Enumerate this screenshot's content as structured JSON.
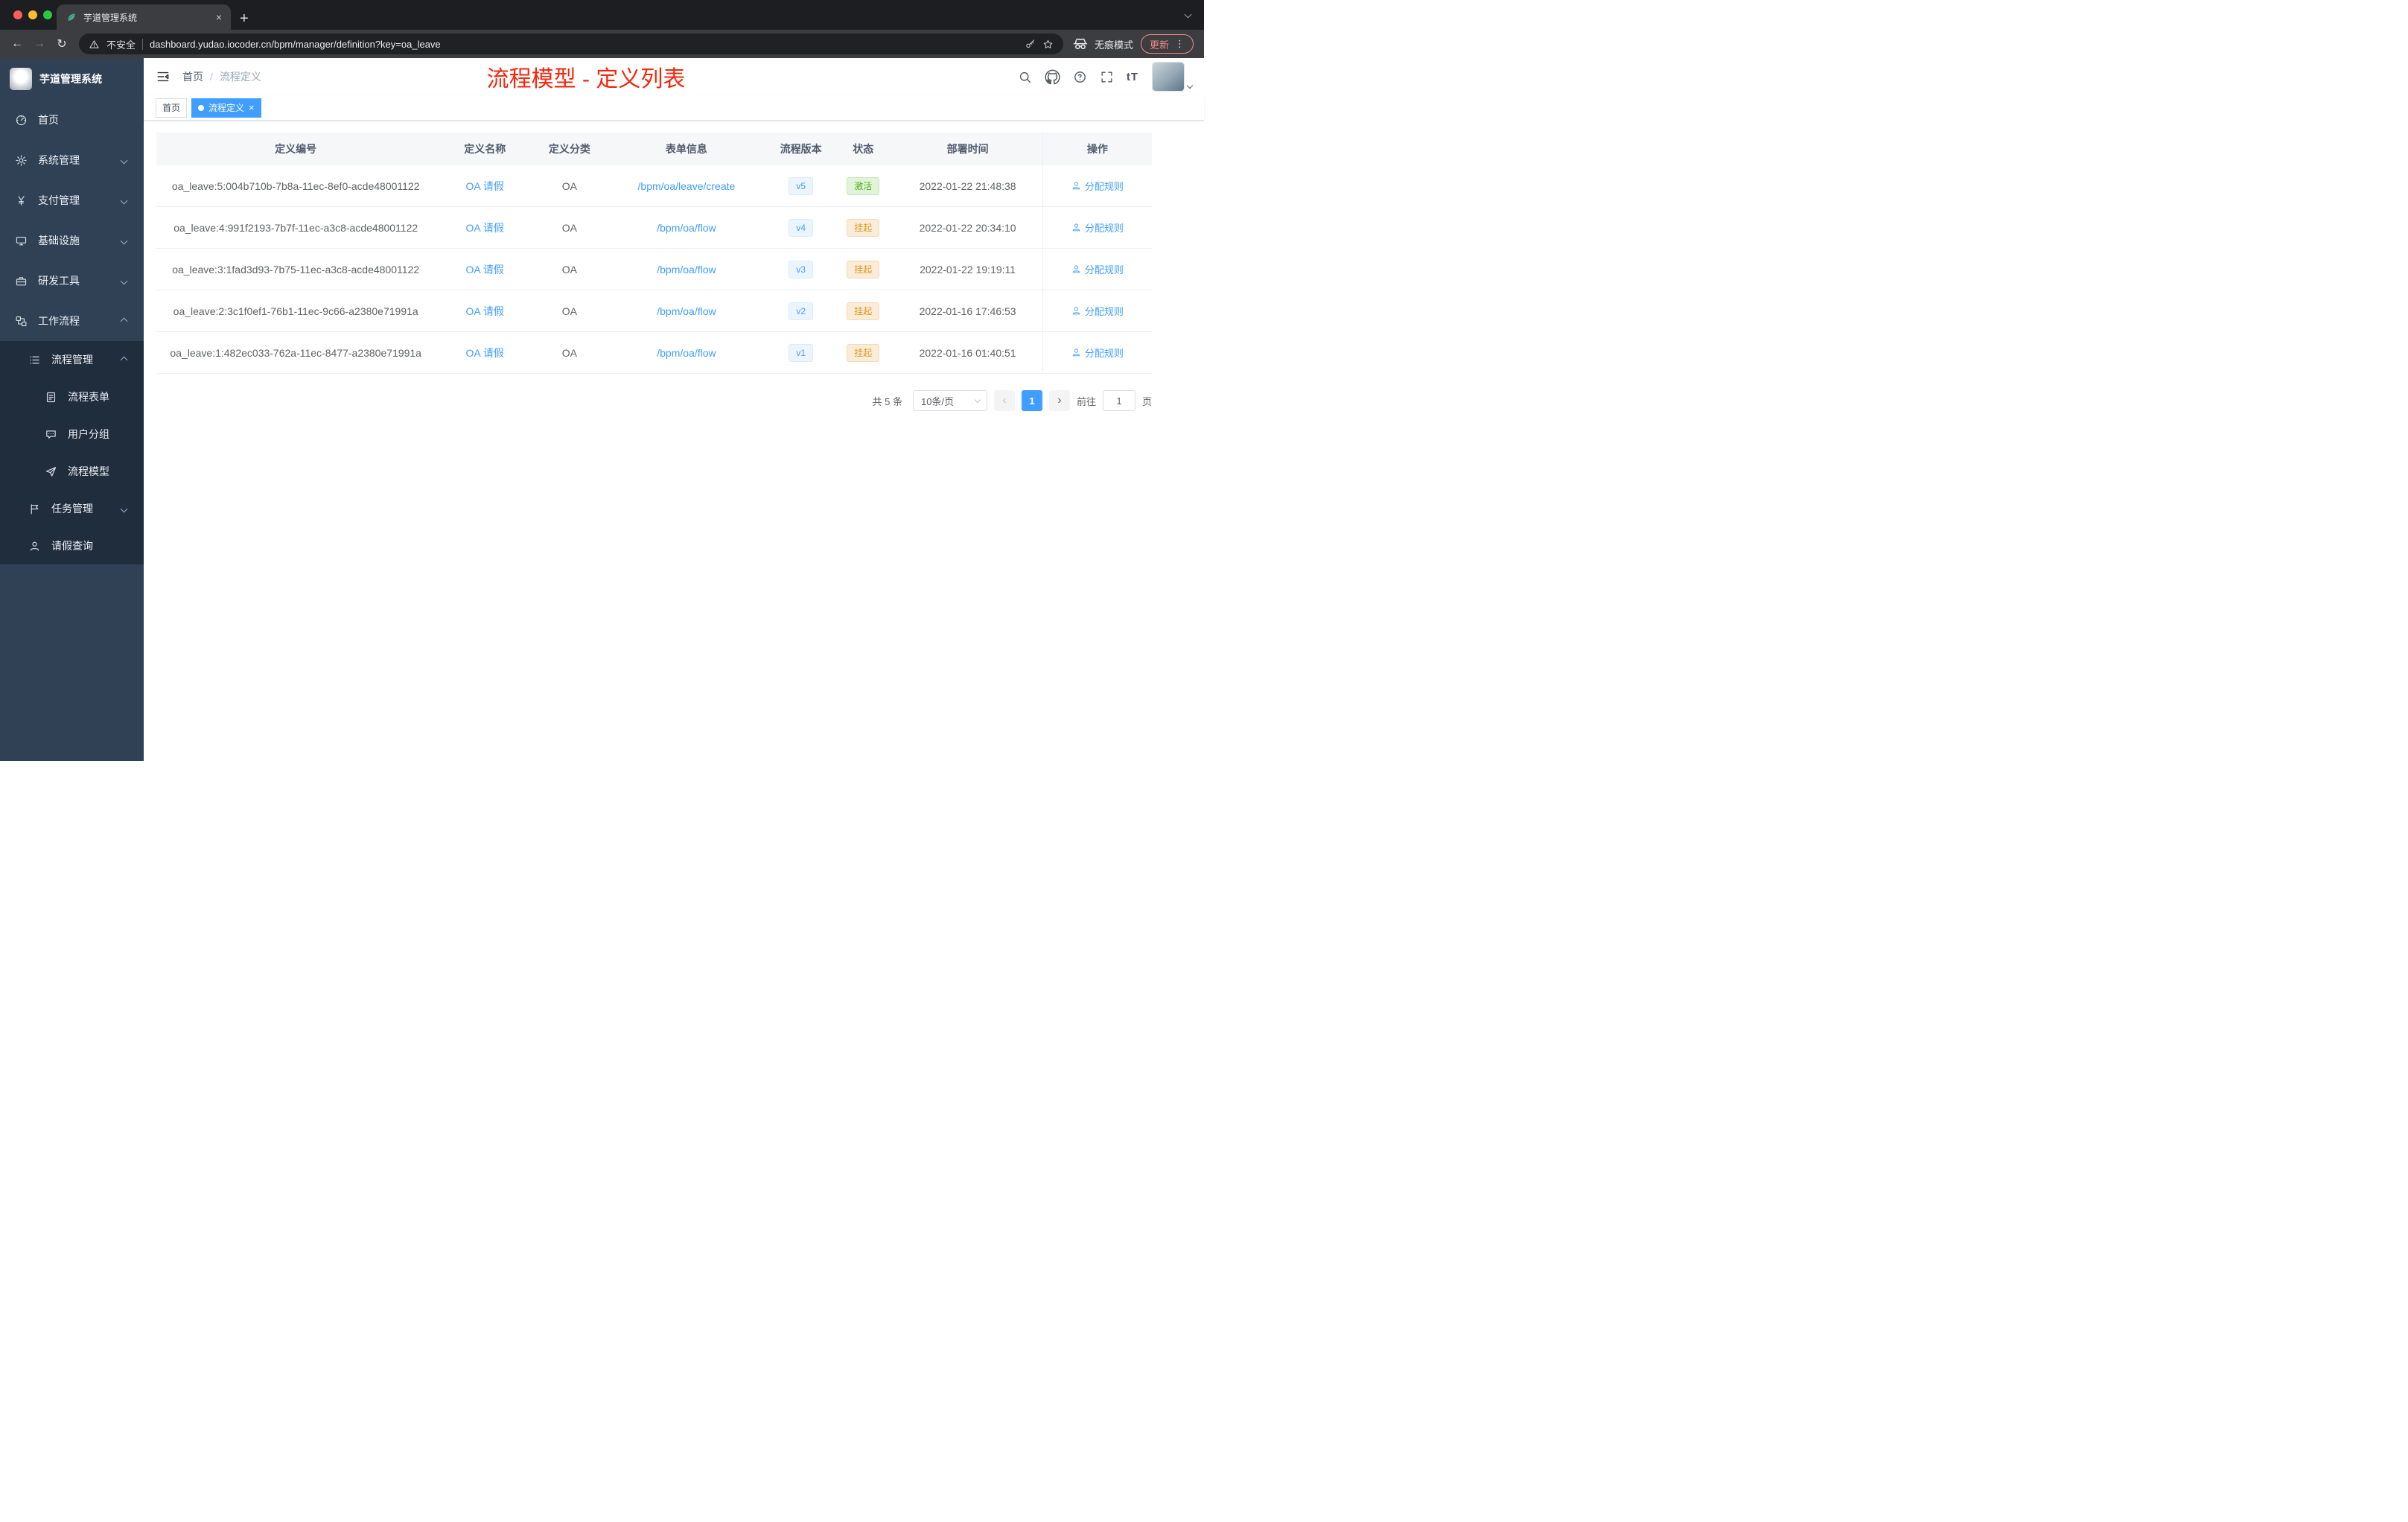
{
  "colors": {
    "accent": "#409eff",
    "sidebar_bg": "#304156",
    "submenu_bg": "#1f2d3d",
    "annotation_red": "#f2270c",
    "status_active_text": "#58b025",
    "status_suspend_text": "#dc9a22",
    "tag_active_bg": "#409eff"
  },
  "glyphs": {
    "close": "×",
    "plus": "+",
    "kebab": "⋮",
    "back": "←",
    "forward": "→",
    "reload": "↻",
    "prev": "‹",
    "next": "›"
  },
  "browser": {
    "tab_title": "芋道管理系统",
    "security_label": "不安全",
    "url": "dashboard.yudao.iocoder.cn/bpm/manager/definition?key=oa_leave",
    "incognito_label": "无痕模式",
    "update_label": "更新"
  },
  "sidebar": {
    "title": "芋道管理系统",
    "menu": [
      {
        "id": "home",
        "label": "首页",
        "icon": "dashboard",
        "level": 1,
        "chevron": ""
      },
      {
        "id": "system",
        "label": "系统管理",
        "icon": "gear",
        "level": 1,
        "chevron": "down"
      },
      {
        "id": "payment",
        "label": "支付管理",
        "icon": "yen",
        "level": 1,
        "chevron": "down"
      },
      {
        "id": "infrastructure",
        "label": "基础设施",
        "icon": "monitor",
        "level": 1,
        "chevron": "down"
      },
      {
        "id": "devtools",
        "label": "研发工具",
        "icon": "toolbox",
        "level": 1,
        "chevron": "down"
      },
      {
        "id": "workflow",
        "label": "工作流程",
        "icon": "workflow",
        "level": 1,
        "chevron": "up"
      },
      {
        "id": "process-manage",
        "label": "流程管理",
        "icon": "list",
        "level": 2,
        "chevron": "up"
      },
      {
        "id": "process-form",
        "label": "流程表单",
        "icon": "form",
        "level": 3,
        "chevron": ""
      },
      {
        "id": "user-group",
        "label": "用户分组",
        "icon": "group",
        "level": 3,
        "chevron": ""
      },
      {
        "id": "process-model",
        "label": "流程模型",
        "icon": "model",
        "level": 3,
        "chevron": ""
      },
      {
        "id": "task-manage",
        "label": "任务管理",
        "icon": "task",
        "level": 2,
        "chevron": "down"
      },
      {
        "id": "leave-query",
        "label": "请假查询",
        "icon": "person",
        "level": 2,
        "chevron": ""
      }
    ]
  },
  "header": {
    "breadcrumb": [
      "首页",
      "流程定义"
    ],
    "breadcrumb_sep": "/",
    "annotation": "流程模型 - 定义列表",
    "font_size_label": "tT"
  },
  "tags": [
    {
      "label": "首页",
      "active": false
    },
    {
      "label": "流程定义",
      "active": true
    }
  ],
  "table": {
    "columns": [
      "定义编号",
      "定义名称",
      "定义分类",
      "表单信息",
      "流程版本",
      "状态",
      "部署时间",
      "操作"
    ],
    "rows": [
      {
        "id": "oa_leave:5:004b710b-7b8a-11ec-8ef0-acde48001122",
        "name": "OA 请假",
        "category": "OA",
        "form": "/bpm/oa/leave/create",
        "version": "v5",
        "status": "激活",
        "status_type": "success",
        "time": "2022-01-22 21:48:38",
        "action": "分配规则"
      },
      {
        "id": "oa_leave:4:991f2193-7b7f-11ec-a3c8-acde48001122",
        "name": "OA 请假",
        "category": "OA",
        "form": "/bpm/oa/flow",
        "version": "v4",
        "status": "挂起",
        "status_type": "warning",
        "time": "2022-01-22 20:34:10",
        "action": "分配规则"
      },
      {
        "id": "oa_leave:3:1fad3d93-7b75-11ec-a3c8-acde48001122",
        "name": "OA 请假",
        "category": "OA",
        "form": "/bpm/oa/flow",
        "version": "v3",
        "status": "挂起",
        "status_type": "warning",
        "time": "2022-01-22 19:19:11",
        "action": "分配规则"
      },
      {
        "id": "oa_leave:2:3c1f0ef1-76b1-11ec-9c66-a2380e71991a",
        "name": "OA 请假",
        "category": "OA",
        "form": "/bpm/oa/flow",
        "version": "v2",
        "status": "挂起",
        "status_type": "warning",
        "time": "2022-01-16 17:46:53",
        "action": "分配规则"
      },
      {
        "id": "oa_leave:1:482ec033-762a-11ec-8477-a2380e71991a",
        "name": "OA 请假",
        "category": "OA",
        "form": "/bpm/oa/flow",
        "version": "v1",
        "status": "挂起",
        "status_type": "warning",
        "time": "2022-01-16 01:40:51",
        "action": "分配规则"
      }
    ]
  },
  "pagination": {
    "total": "共 5 条",
    "page_size": "10条/页",
    "current": "1",
    "goto_label": "前往",
    "goto_value": "1",
    "page_unit": "页"
  }
}
